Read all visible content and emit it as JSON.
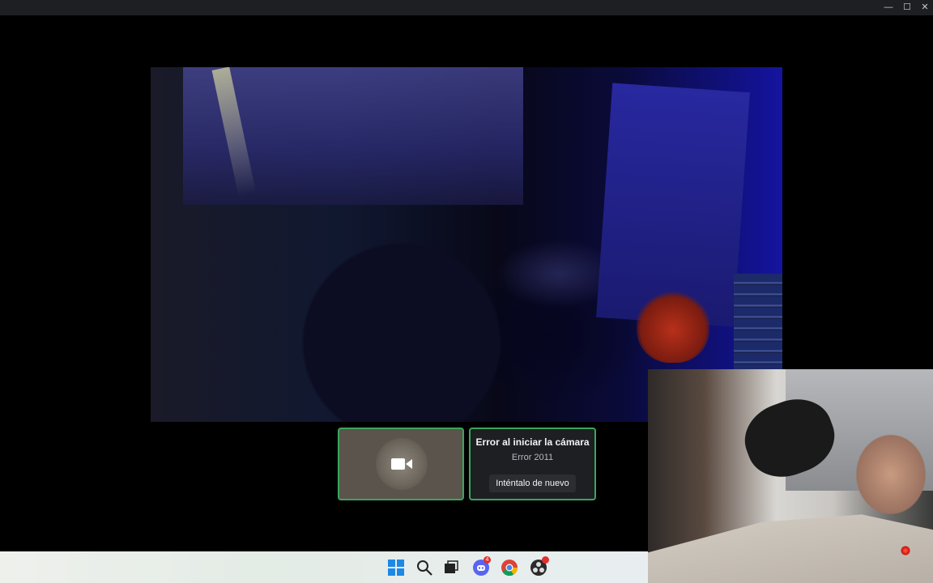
{
  "window": {
    "controls": {
      "minimize_glyph": "—",
      "maximize_glyph": "☐",
      "close_glyph": "✕"
    }
  },
  "call": {
    "camera_error": {
      "title": "Error al iniciar la cámara",
      "code": "Error 2011",
      "retry_label": "Inténtalo de nuevo"
    },
    "self_tile": {
      "icon": "video-camera-icon"
    },
    "speaking_border_color": "#3ba55d"
  },
  "taskbar": {
    "items": [
      {
        "name": "windows-start-icon"
      },
      {
        "name": "search-icon"
      },
      {
        "name": "task-view-icon"
      },
      {
        "name": "discord-icon",
        "badge": "4"
      },
      {
        "name": "chrome-icon"
      },
      {
        "name": "obs-icon",
        "badge": ""
      }
    ]
  }
}
